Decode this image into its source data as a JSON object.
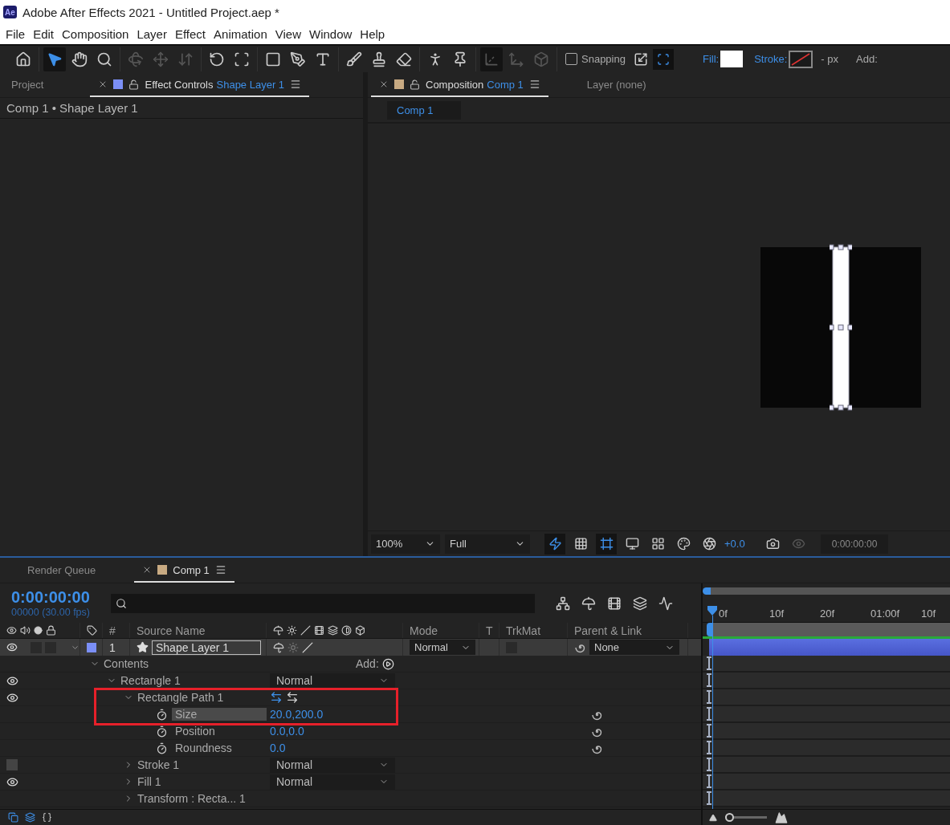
{
  "window": {
    "app_badge": "Ae",
    "title": "Adobe After Effects 2021 - Untitled Project.aep *"
  },
  "menu": [
    "File",
    "Edit",
    "Composition",
    "Layer",
    "Effect",
    "Animation",
    "View",
    "Window",
    "Help"
  ],
  "toolbar": {
    "tool_groups": [
      [
        {
          "kind": "home",
          "selected": false,
          "disabled": false
        }
      ],
      [
        {
          "kind": "selection",
          "selected": true,
          "disabled": false
        },
        {
          "kind": "hand",
          "selected": false,
          "disabled": false
        },
        {
          "kind": "zoom",
          "selected": false,
          "disabled": false
        }
      ],
      [
        {
          "kind": "orbit",
          "selected": false,
          "disabled": true
        },
        {
          "kind": "pan",
          "selected": false,
          "disabled": true
        },
        {
          "kind": "dolly",
          "selected": false,
          "disabled": true
        }
      ],
      [
        {
          "kind": "rotate",
          "selected": false,
          "disabled": false
        },
        {
          "kind": "pan-behind",
          "selected": false,
          "disabled": false
        }
      ],
      [
        {
          "kind": "rectangle",
          "selected": false,
          "disabled": false
        },
        {
          "kind": "pen",
          "selected": false,
          "disabled": false
        },
        {
          "kind": "type",
          "selected": false,
          "disabled": false
        }
      ],
      [
        {
          "kind": "brush",
          "selected": false,
          "disabled": false
        },
        {
          "kind": "clone",
          "selected": false,
          "disabled": false
        },
        {
          "kind": "eraser",
          "selected": false,
          "disabled": false
        }
      ],
      [
        {
          "kind": "roto",
          "selected": false,
          "disabled": false
        },
        {
          "kind": "puppet",
          "selected": false,
          "disabled": false
        }
      ],
      [
        {
          "kind": "axis-local",
          "selected": true,
          "disabled": true
        },
        {
          "kind": "axis-world",
          "selected": false,
          "disabled": true
        },
        {
          "kind": "axis-view",
          "selected": false,
          "disabled": true
        }
      ]
    ],
    "snapping": {
      "label": "Snapping",
      "checked": false
    },
    "fill_label": "Fill:",
    "stroke_label": "Stroke:",
    "stroke_width": "- px",
    "add_label": "Add:"
  },
  "left_panel": {
    "tabs": [
      {
        "label": "Project",
        "selected": false
      },
      {
        "label": "Effect Controls",
        "subject": "Shape Layer 1",
        "color": "#7b8ff7",
        "selected": true
      }
    ],
    "breadcrumb": "Comp 1 • Shape Layer 1"
  },
  "viewer": {
    "tabs": [
      {
        "label": "Composition",
        "subject": "Comp 1",
        "color": "#c8aa82",
        "selected": true
      },
      {
        "label": "Layer (none)",
        "selected": false
      }
    ],
    "flow_chip": "Comp 1",
    "zoom": "100%",
    "resolution": "Full",
    "controls": [
      {
        "kind": "fast-previews",
        "on": true
      },
      {
        "kind": "transparency-grid",
        "on": false
      },
      {
        "kind": "mask-visibility",
        "on": true
      },
      {
        "kind": "region",
        "on": false
      },
      {
        "kind": "guides",
        "on": false
      },
      {
        "kind": "channel",
        "on": false
      },
      {
        "kind": "exposure-reset",
        "on": false
      },
      {
        "kind": "exposure",
        "label": "+0.0"
      },
      {
        "kind": "snapshot",
        "on": false
      },
      {
        "kind": "show-snapshot",
        "on": false
      }
    ],
    "timecode": "0:00:00:00"
  },
  "timeline": {
    "tabs": [
      {
        "label": "Render Queue",
        "selected": false
      },
      {
        "label": "Comp 1",
        "color": "#c8aa82",
        "selected": true
      }
    ],
    "timecode": "0:00:00:00",
    "frame_info": "00000 (30.00 fps)",
    "columns": {
      "number": "#",
      "source_name": "Source Name",
      "mode": "Mode",
      "t": "T",
      "trkmat": "TrkMat",
      "parent": "Parent & Link"
    },
    "layer": {
      "number": "1",
      "name": "Shape Layer 1",
      "color": "#7b8ff7",
      "visible": true,
      "expanded": true,
      "selected": true,
      "mode": "Normal",
      "parent": "None"
    },
    "tree": [
      {
        "kind": "group",
        "label": "Contents",
        "expanded": true,
        "highlighted": false,
        "add_label": "Add:",
        "children": [
          {
            "kind": "group",
            "label": "Rectangle 1",
            "expanded": true,
            "visible": true,
            "highlighted": false,
            "mode": "Normal",
            "children": [
              {
                "kind": "path",
                "label": "Rectangle Path 1",
                "expanded": true,
                "visible": true,
                "highlighted": true,
                "children": [
                  {
                    "kind": "property",
                    "label": "Size",
                    "value": "20.0,200.0",
                    "selected": true,
                    "highlighted": true
                  },
                  {
                    "kind": "property",
                    "label": "Position",
                    "value": "0.0,0.0",
                    "selected": false,
                    "highlighted": false
                  },
                  {
                    "kind": "property",
                    "label": "Roundness",
                    "value": "0.0",
                    "selected": false,
                    "highlighted": false
                  }
                ]
              },
              {
                "kind": "group",
                "label": "Stroke 1",
                "expanded": false,
                "visible": false,
                "highlighted": false,
                "mode": "Normal"
              },
              {
                "kind": "group",
                "label": "Fill 1",
                "expanded": false,
                "visible": true,
                "highlighted": false,
                "mode": "Normal"
              },
              {
                "kind": "group",
                "label": "Transform : Recta... 1",
                "expanded": false,
                "highlighted": false
              }
            ]
          }
        ]
      }
    ],
    "ruler": [
      "0f",
      "10f",
      "20f",
      "01:00f",
      "10f"
    ],
    "zoom_slider": {
      "level": 0
    }
  }
}
